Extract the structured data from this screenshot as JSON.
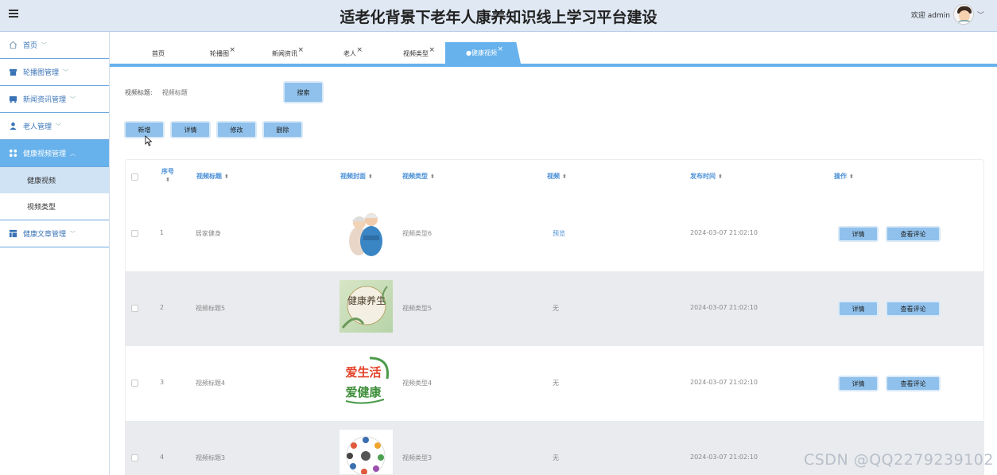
{
  "header": {
    "title": "适老化背景下老年人康养知识线上学习平台建设",
    "welcome": "欢迎 admin"
  },
  "sidebar": {
    "items": [
      {
        "label": "首页"
      },
      {
        "label": "轮播图管理"
      },
      {
        "label": "新闻资讯管理"
      },
      {
        "label": "老人管理"
      },
      {
        "label": "健康视频管理"
      },
      {
        "label": "健康文章管理"
      }
    ],
    "sub_items": [
      {
        "label": "健康视频"
      },
      {
        "label": "视频类型"
      }
    ]
  },
  "tabs": [
    {
      "label": "首页"
    },
    {
      "label": "轮播图"
    },
    {
      "label": "新闻资讯"
    },
    {
      "label": "老人"
    },
    {
      "label": "视频类型"
    },
    {
      "label": "●健康视频"
    }
  ],
  "search": {
    "label": "视频标题:",
    "placeholder": "视频标题",
    "button": "搜索"
  },
  "actions": {
    "add": "新增",
    "detail": "详情",
    "edit": "修改",
    "delete": "删除"
  },
  "table": {
    "columns": [
      "序号",
      "视频标题",
      "视频封面",
      "视频类型",
      "视频",
      "发布时间",
      "操作"
    ],
    "detail_btn": "详情",
    "comment_btn": "查看评论",
    "rows": [
      {
        "index": "1",
        "title": "居家健身",
        "type": "视频类型6",
        "video": "预览",
        "time": "2024-03-07 21:02:10"
      },
      {
        "index": "2",
        "title": "视频标题5",
        "type": "视频类型5",
        "video": "无",
        "time": "2024-03-07 21:02:10"
      },
      {
        "index": "3",
        "title": "视频标题4",
        "type": "视频类型4",
        "video": "无",
        "time": "2024-03-07 21:02:10"
      },
      {
        "index": "4",
        "title": "视频标题3",
        "type": "视频类型3",
        "video": "无",
        "time": "2024-03-07 21:02:10"
      }
    ],
    "cover_texts": {
      "cover2": "健康养生",
      "cover3_top": "爱生活",
      "cover3_bottom": "爱健康"
    }
  },
  "watermark": "CSDN @QQ2279239102",
  "colors": {
    "accent": "#67b2ec",
    "button": "#8fc1ec",
    "header_bg": "#dfe8f3",
    "link": "#4a90d6"
  }
}
